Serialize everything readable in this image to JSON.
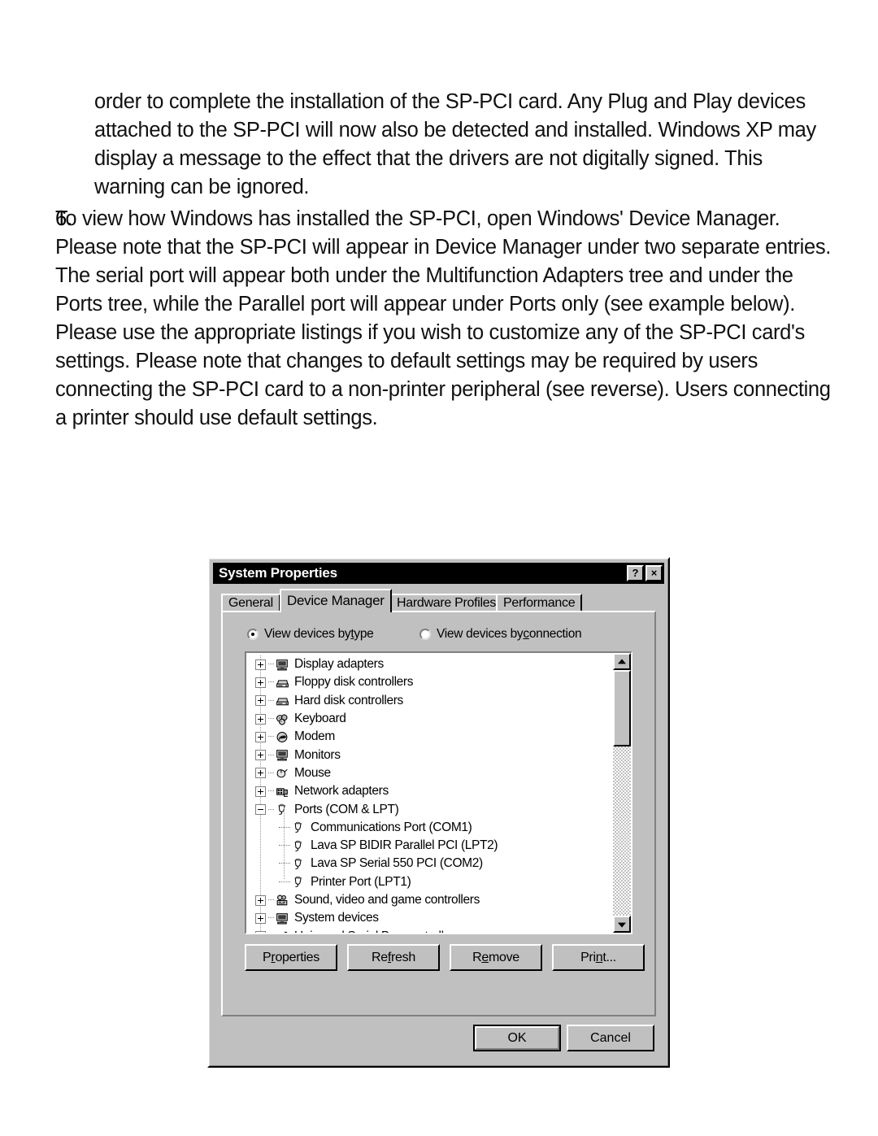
{
  "document": {
    "intro_paragraph": "order to complete the installation of the SP-PCI card. Any Plug and Play devices attached to the SP-PCI will now also be detected and installed. Windows XP may display a message to the effect that the drivers are not digitally signed. This warning can be ignored.",
    "step": {
      "number": "6.",
      "text": "To view how Windows has installed the SP-PCI, open Windows' Device Manager. Please note that the SP-PCI will appear in Device Manager under two separate entries. The serial port will appear both under the Multifunction Adapters tree and under the Ports tree, while the Parallel port will appear under Ports only (see example below). Please use the appropriate listings if you wish to customize any of the SP-PCI card's settings. Please note that changes to default settings may be required by users connecting the SP-PCI card to a non-printer peripheral (see reverse). Users connecting a printer should use default settings."
    }
  },
  "dialog": {
    "title": "System Properties",
    "titlebar_buttons": [
      {
        "name": "help-button",
        "glyph": "?"
      },
      {
        "name": "close-button",
        "glyph": "×"
      }
    ],
    "tabs": [
      {
        "label": "General",
        "active": false
      },
      {
        "label": "Device Manager",
        "active": true
      },
      {
        "label": "Hardware Profiles",
        "active": false
      },
      {
        "label": "Performance",
        "active": false
      }
    ],
    "view_options": [
      {
        "label_pre": "View devices by ",
        "accel": "t",
        "label_post": "ype",
        "checked": true
      },
      {
        "label_pre": "View devices by ",
        "accel": "c",
        "label_post": "onnection",
        "checked": false
      }
    ],
    "tree": [
      {
        "label": "Display adapters",
        "level": 0,
        "expander": "plus",
        "icon": "monitor-icon"
      },
      {
        "label": "Floppy disk controllers",
        "level": 0,
        "expander": "plus",
        "icon": "drive-icon"
      },
      {
        "label": "Hard disk controllers",
        "level": 0,
        "expander": "plus",
        "icon": "drive-icon"
      },
      {
        "label": "Keyboard",
        "level": 0,
        "expander": "plus",
        "icon": "keyboard-icon"
      },
      {
        "label": "Modem",
        "level": 0,
        "expander": "plus",
        "icon": "modem-icon"
      },
      {
        "label": "Monitors",
        "level": 0,
        "expander": "plus",
        "icon": "monitor-icon"
      },
      {
        "label": "Mouse",
        "level": 0,
        "expander": "plus",
        "icon": "mouse-icon"
      },
      {
        "label": "Network adapters",
        "level": 0,
        "expander": "plus",
        "icon": "network-card-icon"
      },
      {
        "label": "Ports (COM & LPT)",
        "level": 0,
        "expander": "minus",
        "icon": "port-icon"
      },
      {
        "label": "Communications Port (COM1)",
        "level": 1,
        "expander": "none",
        "icon": "port-icon"
      },
      {
        "label": "Lava SP BIDIR Parallel PCI (LPT2)",
        "level": 1,
        "expander": "none",
        "icon": "port-icon"
      },
      {
        "label": "Lava SP Serial 550 PCI (COM2)",
        "level": 1,
        "expander": "none",
        "icon": "port-icon"
      },
      {
        "label": "Printer Port (LPT1)",
        "level": 1,
        "expander": "none",
        "icon": "port-icon"
      },
      {
        "label": "Sound, video and game controllers",
        "level": 0,
        "expander": "plus",
        "icon": "sound-icon"
      },
      {
        "label": "System devices",
        "level": 0,
        "expander": "plus",
        "icon": "computer-icon"
      },
      {
        "label": "Universal Serial Bus controllers",
        "level": 0,
        "expander": "plus",
        "icon": "usb-icon"
      }
    ],
    "action_buttons": [
      {
        "name": "properties-button",
        "pre": "P",
        "accel": "r",
        "post": "operties"
      },
      {
        "name": "refresh-button",
        "pre": "Re",
        "accel": "f",
        "post": "resh"
      },
      {
        "name": "remove-button",
        "pre": "R",
        "accel": "e",
        "post": "move"
      },
      {
        "name": "print-button",
        "pre": "Pri",
        "accel": "n",
        "post": "t..."
      }
    ],
    "ok_label": "OK",
    "cancel_label": "Cancel",
    "colors": {
      "face": "#c0c0c0",
      "titlebar": "#000000",
      "titlebar_text": "#ffffff",
      "list_background": "#ffffff",
      "shadow": "#808080",
      "highlight": "#ffffff"
    }
  }
}
